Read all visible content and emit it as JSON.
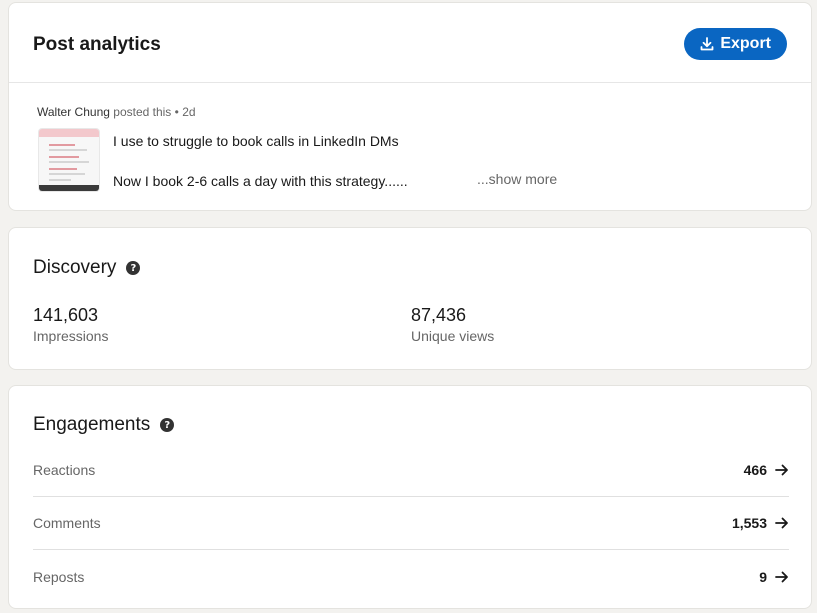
{
  "header": {
    "title": "Post analytics",
    "export_label": "Export"
  },
  "post": {
    "author": "Walter Chung",
    "action": "posted this",
    "age": "2d",
    "line1": "I use to struggle to book calls in LinkedIn DMs",
    "line2": "Now I book 2-6 calls a day with this strategy......",
    "show_more": "...show more"
  },
  "discovery": {
    "title": "Discovery",
    "metrics": [
      {
        "value": "141,603",
        "label": "Impressions"
      },
      {
        "value": "87,436",
        "label": "Unique views"
      }
    ]
  },
  "engagements": {
    "title": "Engagements",
    "rows": [
      {
        "label": "Reactions",
        "value": "466"
      },
      {
        "label": "Comments",
        "value": "1,553"
      },
      {
        "label": "Reposts",
        "value": "9"
      }
    ]
  },
  "colors": {
    "accent": "#0a66c2",
    "background": "#f3f2ef"
  },
  "icons": {
    "export": "download-icon",
    "help": "question-circle-icon",
    "row_arrow": "arrow-right-icon"
  }
}
